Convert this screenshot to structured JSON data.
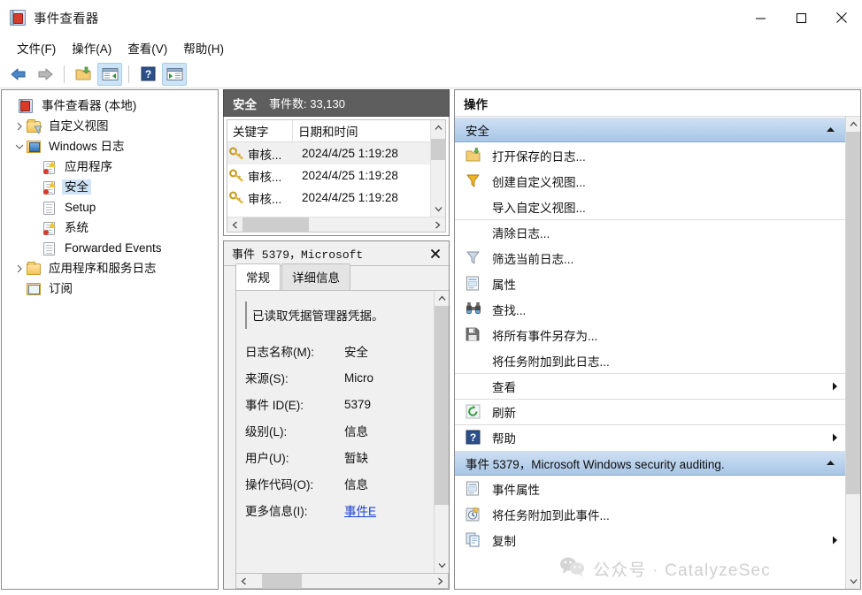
{
  "window": {
    "title": "事件查看器",
    "icon": "event-viewer-icon",
    "controls": {
      "minimize": "minimize-icon",
      "maximize": "maximize-icon",
      "close": "close-icon"
    }
  },
  "menu": {
    "items": [
      {
        "label": "文件(F)",
        "name": "menu-file"
      },
      {
        "label": "操作(A)",
        "name": "menu-action"
      },
      {
        "label": "查看(V)",
        "name": "menu-view"
      },
      {
        "label": "帮助(H)",
        "name": "menu-help"
      }
    ]
  },
  "toolbar": {
    "buttons": [
      {
        "icon": "back-arrow-icon",
        "active": false
      },
      {
        "icon": "forward-arrow-icon",
        "active": false
      },
      {
        "icon": "open-folder-icon",
        "active": false
      },
      {
        "icon": "show-tree-pane-icon",
        "active": true
      },
      {
        "icon": "help-icon",
        "active": false
      },
      {
        "icon": "show-action-pane-icon",
        "active": true
      }
    ]
  },
  "tree": {
    "nodes": [
      {
        "label": "事件查看器 (本地)",
        "indent": 0,
        "icon": "event-viewer-icon",
        "twisty": "none",
        "selected": false
      },
      {
        "label": "自定义视图",
        "indent": 1,
        "icon": "folder-filter-icon",
        "twisty": "collapsed",
        "selected": false
      },
      {
        "label": "Windows 日志",
        "indent": 1,
        "icon": "folder-monitor-icon",
        "twisty": "expanded",
        "selected": false
      },
      {
        "label": "应用程序",
        "indent": 2,
        "icon": "log-warn-icon",
        "twisty": "none",
        "selected": false
      },
      {
        "label": "安全",
        "indent": 2,
        "icon": "log-warn-icon",
        "twisty": "none",
        "selected": true
      },
      {
        "label": "Setup",
        "indent": 2,
        "icon": "log-plain-icon",
        "twisty": "none",
        "selected": false
      },
      {
        "label": "系统",
        "indent": 2,
        "icon": "log-warn-icon",
        "twisty": "none",
        "selected": false
      },
      {
        "label": "Forwarded Events",
        "indent": 2,
        "icon": "log-plain-icon",
        "twisty": "none",
        "selected": false
      },
      {
        "label": "应用程序和服务日志",
        "indent": 1,
        "icon": "folder-icon",
        "twisty": "collapsed",
        "selected": false
      },
      {
        "label": "订阅",
        "indent": 1,
        "icon": "subscription-icon",
        "twisty": "none",
        "selected": false
      }
    ]
  },
  "middle": {
    "header": {
      "name": "安全",
      "count_label": "事件数: 33,130"
    },
    "columns": [
      {
        "label": "关键字",
        "name": "col-keywords"
      },
      {
        "label": "日期和时间",
        "name": "col-datetime"
      }
    ],
    "rows": [
      {
        "icon": "key-icon",
        "keywords": "审核...",
        "datetime": "2024/4/25 1:19:28",
        "selected": true
      },
      {
        "icon": "key-icon",
        "keywords": "审核...",
        "datetime": "2024/4/25 1:19:28",
        "selected": false
      },
      {
        "icon": "key-icon",
        "keywords": "审核...",
        "datetime": "2024/4/25 1:19:28",
        "selected": false
      }
    ]
  },
  "detail": {
    "title": "事件 5379，Microsoft",
    "close_icon": "close-icon",
    "tabs": [
      {
        "label": "常规",
        "active": true,
        "name": "tab-general"
      },
      {
        "label": "详细信息",
        "active": false,
        "name": "tab-details"
      }
    ],
    "message": "已读取凭据管理器凭据。",
    "fields": [
      {
        "label": "日志名称(M):",
        "value": "安全",
        "link": false
      },
      {
        "label": "来源(S):",
        "value": "Micro",
        "link": false
      },
      {
        "label": "事件 ID(E):",
        "value": "5379",
        "link": false
      },
      {
        "label": "级别(L):",
        "value": "信息",
        "link": false
      },
      {
        "label": "用户(U):",
        "value": "暂缺",
        "link": false
      },
      {
        "label": "操作代码(O):",
        "value": "信息",
        "link": false
      },
      {
        "label": "更多信息(I):",
        "value": "事件E",
        "link": true
      }
    ]
  },
  "actions": {
    "header": "操作",
    "groups": [
      {
        "title": "安全",
        "name": "action-group-security",
        "caret": "collapse-caret-icon",
        "items": [
          {
            "label": "打开保存的日志...",
            "icon": "open-folder-icon",
            "name": "action-open-saved-log",
            "separator": false,
            "submenu": false
          },
          {
            "label": "创建自定义视图...",
            "icon": "filter-icon",
            "name": "action-create-custom-view",
            "separator": false,
            "submenu": false
          },
          {
            "label": "导入自定义视图...",
            "icon": "none",
            "name": "action-import-custom-view",
            "separator": false,
            "submenu": false
          },
          {
            "label": "清除日志...",
            "icon": "none",
            "name": "action-clear-log",
            "separator": true,
            "submenu": false
          },
          {
            "label": "筛选当前日志...",
            "icon": "filter-icon",
            "name": "action-filter-current-log",
            "separator": false,
            "submenu": false
          },
          {
            "label": "属性",
            "icon": "properties-icon",
            "name": "action-properties",
            "separator": false,
            "submenu": false
          },
          {
            "label": "查找...",
            "icon": "binoculars-icon",
            "name": "action-find",
            "separator": false,
            "submenu": false
          },
          {
            "label": "将所有事件另存为...",
            "icon": "save-icon",
            "name": "action-save-all-events-as",
            "separator": false,
            "submenu": false
          },
          {
            "label": "将任务附加到此日志...",
            "icon": "none",
            "name": "action-attach-task-to-log",
            "separator": false,
            "submenu": false
          },
          {
            "label": "查看",
            "icon": "none",
            "name": "action-view",
            "separator": true,
            "submenu": true
          },
          {
            "label": "刷新",
            "icon": "refresh-icon",
            "name": "action-refresh",
            "separator": true,
            "submenu": false
          },
          {
            "label": "帮助",
            "icon": "help-icon",
            "name": "action-help",
            "separator": true,
            "submenu": true
          }
        ]
      },
      {
        "title": "事件 5379，Microsoft Windows security auditing.",
        "name": "action-group-event",
        "caret": "collapse-caret-icon",
        "items": [
          {
            "label": "事件属性",
            "icon": "properties-icon",
            "name": "action-event-properties",
            "separator": false,
            "submenu": false
          },
          {
            "label": "将任务附加到此事件...",
            "icon": "attach-task-icon",
            "name": "action-attach-task-to-event",
            "separator": false,
            "submenu": false
          },
          {
            "label": "复制",
            "icon": "copy-icon",
            "name": "action-copy",
            "separator": false,
            "submenu": true
          }
        ]
      }
    ]
  },
  "watermark": {
    "text": "公众号 · CatalyzeSec",
    "icon": "wechat-icon"
  },
  "colors": {
    "mid_header_bg": "#5e5e5e",
    "group_head_top": "#cfe0f3",
    "group_head_bottom": "#a8c6e6",
    "selection": "#cfe4f7",
    "link": "#1f3fd4",
    "watermark": "#c9c9c9"
  }
}
